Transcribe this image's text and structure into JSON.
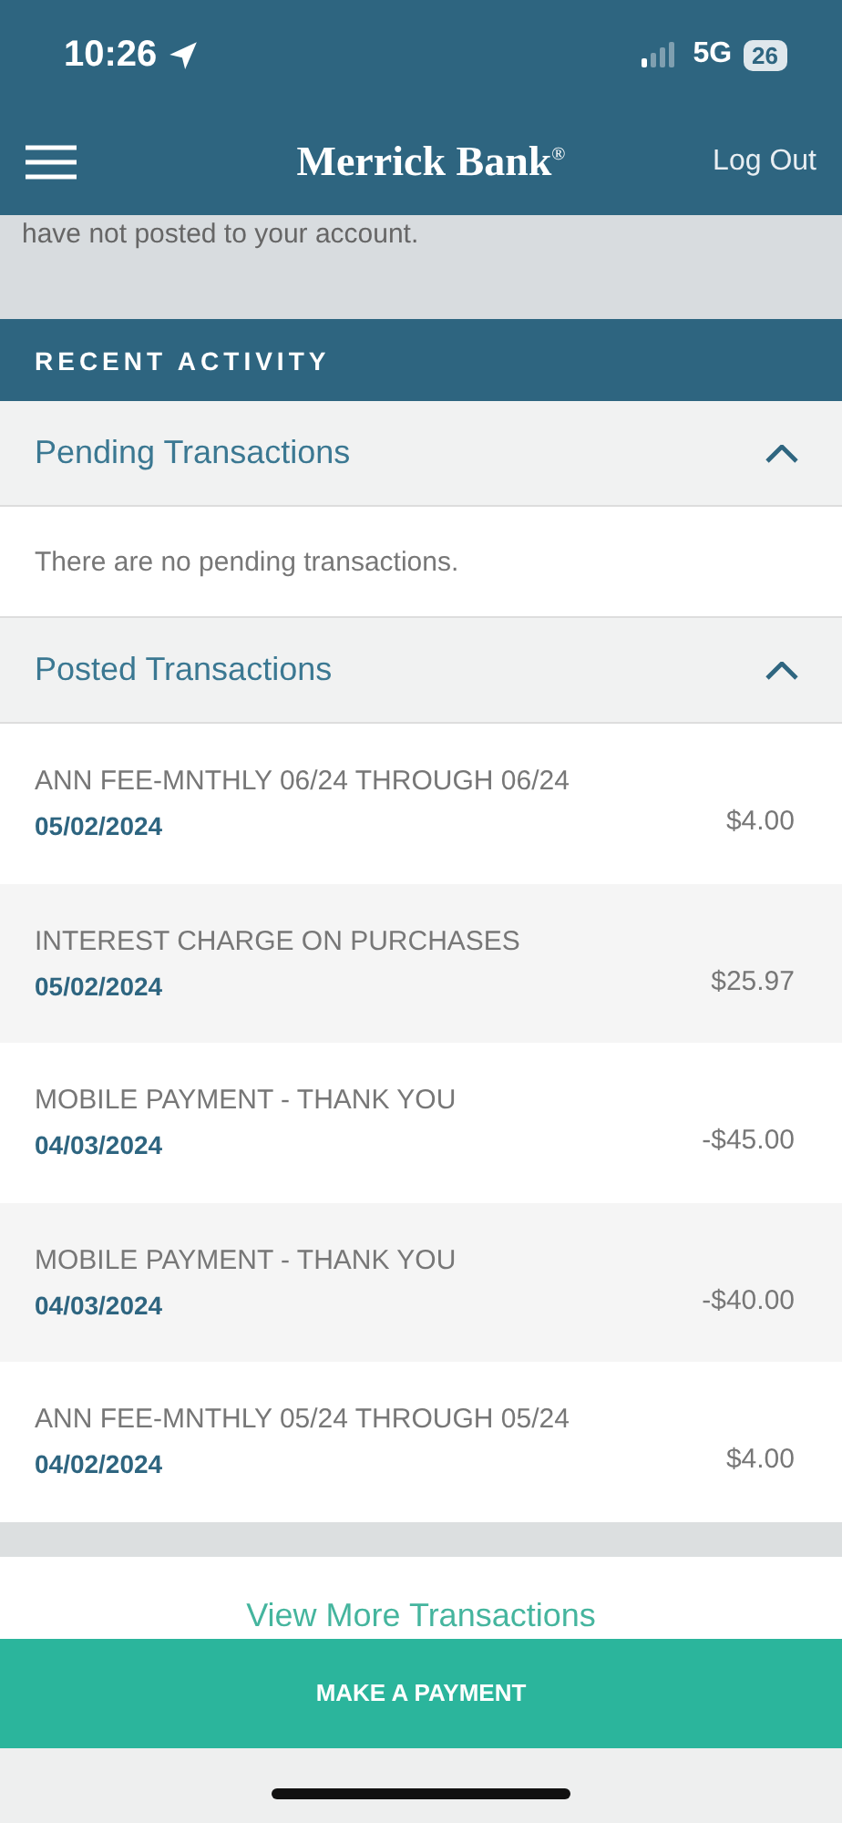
{
  "status_bar": {
    "time": "10:26",
    "network": "5G",
    "battery": "26"
  },
  "nav": {
    "title": "Merrick Bank",
    "title_mark": "®",
    "action": "Log Out"
  },
  "notice": {
    "text": "have not posted to your account."
  },
  "recent_activity": {
    "heading": "RECENT ACTIVITY"
  },
  "sections": [
    {
      "title": "Pending Transactions",
      "expanded": true,
      "empty_text": "There are no pending transactions."
    },
    {
      "title": "Posted Transactions",
      "expanded": true,
      "transactions": [
        {
          "description": "ANN FEE-MNTHLY 06/24 THROUGH 06/24",
          "date": "05/02/2024",
          "amount": "$4.00"
        },
        {
          "description": "INTEREST CHARGE ON PURCHASES",
          "date": "05/02/2024",
          "amount": "$25.97"
        },
        {
          "description": "MOBILE PAYMENT - THANK YOU",
          "date": "04/03/2024",
          "amount": "-$45.00"
        },
        {
          "description": "MOBILE PAYMENT - THANK YOU",
          "date": "04/03/2024",
          "amount": "-$40.00"
        },
        {
          "description": "ANN FEE-MNTHLY 05/24 THROUGH 05/24",
          "date": "04/02/2024",
          "amount": "$4.00"
        }
      ]
    }
  ],
  "view_more": "View More Transactions",
  "payment_button": "MAKE A PAYMENT"
}
